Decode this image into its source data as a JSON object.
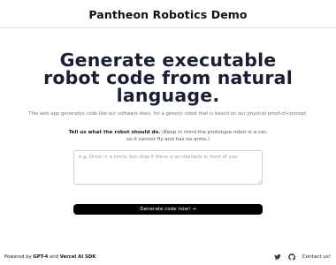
{
  "header": {
    "title": "Pantheon Robotics Demo"
  },
  "hero": {
    "line1": "Generate executable",
    "line2": "robot code from natural",
    "line3": "language."
  },
  "intro": {
    "text": "This web app generates code like our software does, for a generic robot that is based on our physical proof-of-concept."
  },
  "prompt": {
    "label_bold": "Tell us what the robot should do.",
    "label_note_1": "(Keep in mind the prototype robot is a car,",
    "label_note_2": "so it cannot fly and has no arms.)",
    "placeholder": "e.g. Drive in a circle, but stop if there is an obstacle in front of you",
    "value": ""
  },
  "actions": {
    "generate_label": "Generate code now! →"
  },
  "footer": {
    "powered_prefix": "Powered by",
    "powered_gpt": "GPT-4",
    "powered_and": "and",
    "powered_sdk": "Vercel AI SDK",
    "contact_label": "Contact us!",
    "icons": [
      "twitter-icon",
      "github-icon"
    ]
  },
  "colors": {
    "hero_text": "#1b1f33",
    "button_bg": "#000000",
    "button_text": "#ffffff",
    "muted_text": "#6b7280",
    "border": "#e5e5e5"
  }
}
